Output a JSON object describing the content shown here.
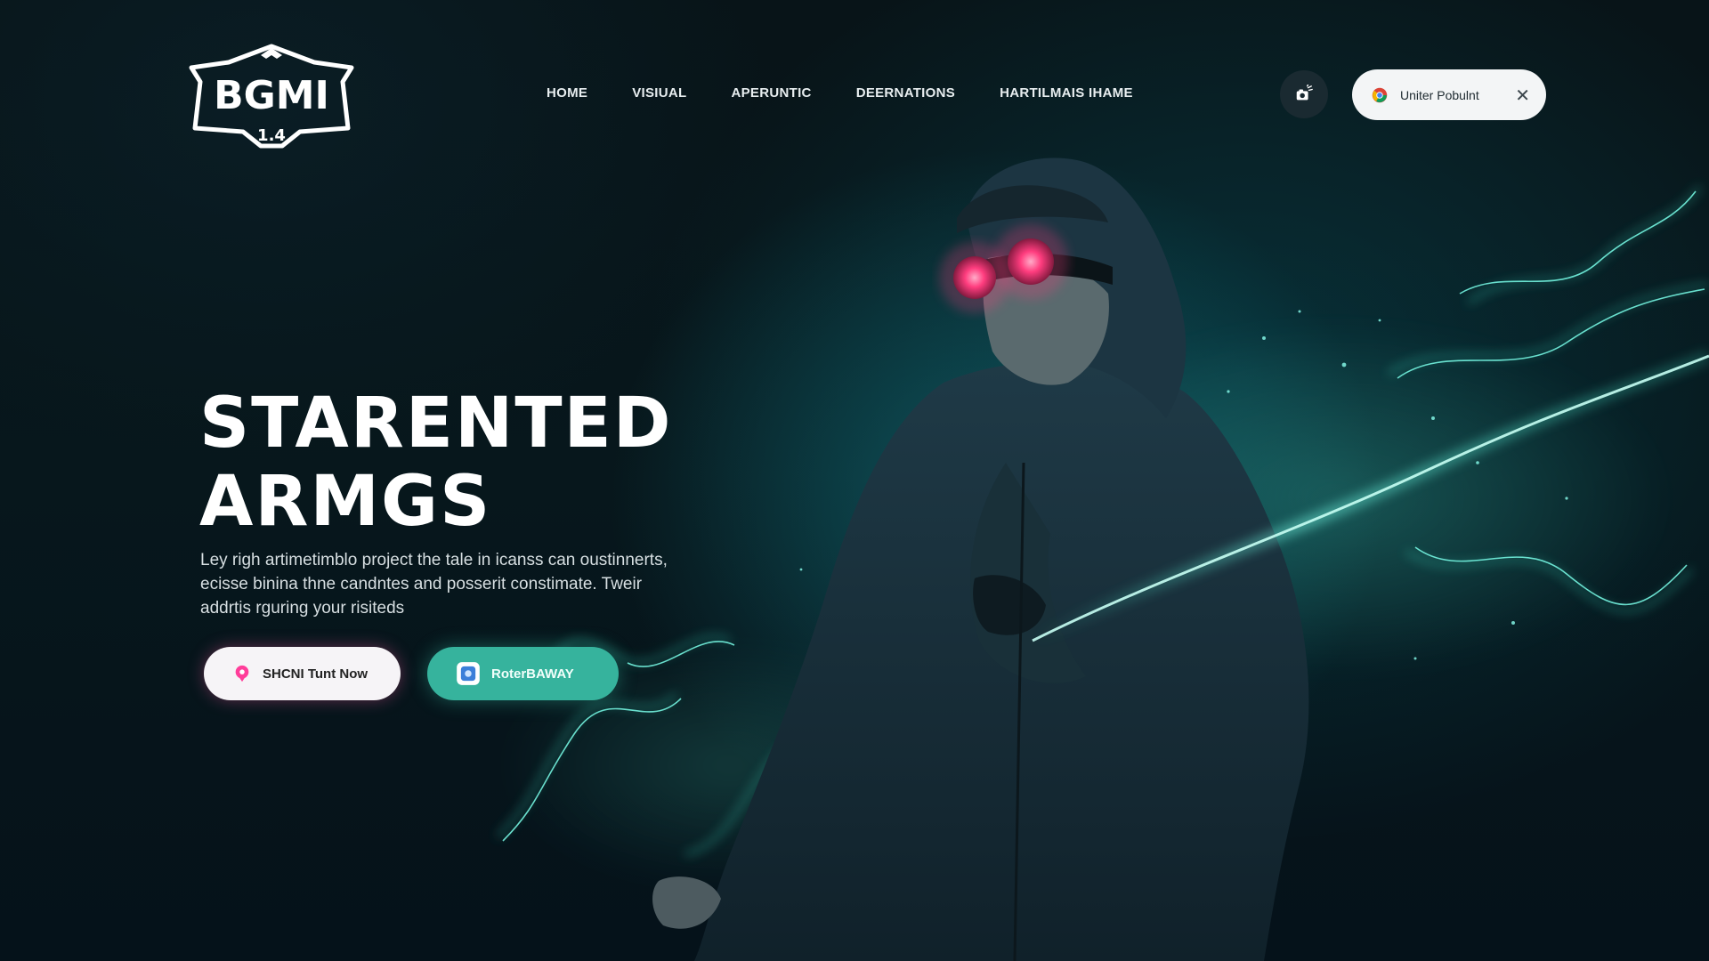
{
  "brand": {
    "logo_text": "BGMI",
    "logo_sub": "1.4"
  },
  "nav": {
    "items": [
      {
        "label": "HOME"
      },
      {
        "label": "VISIUAL"
      },
      {
        "label": "APERUNTIC"
      },
      {
        "label": "DEERNATIONS"
      },
      {
        "label": "HARTILMAIS IHAME"
      }
    ]
  },
  "header": {
    "icon_button": "camera-icon",
    "pill": {
      "label": "Uniter Pobulnt",
      "icon": "chrome-icon",
      "close_icon": "close-icon"
    }
  },
  "hero": {
    "title_line1": "STARENTED",
    "title_line2": "ARMGS",
    "description_lines": [
      "Ley righ artimetimblo project the tale in icanss can oustinnerts,",
      "ecisse binina thne candntes and posserit constimate. Tweir",
      "addrtis rguring your risiteds"
    ],
    "primary_button": {
      "label": "SHCNI Tunt Now",
      "icon": "location-pin-icon"
    },
    "secondary_button": {
      "label": "RoterBAWAY",
      "icon": "app-icon"
    }
  },
  "colors": {
    "background": "#061015",
    "accent_teal": "#36b39d",
    "glow_cyan": "#3ff0d0",
    "goggle_pink": "#ff3d7f",
    "text_light": "#ffffff"
  }
}
